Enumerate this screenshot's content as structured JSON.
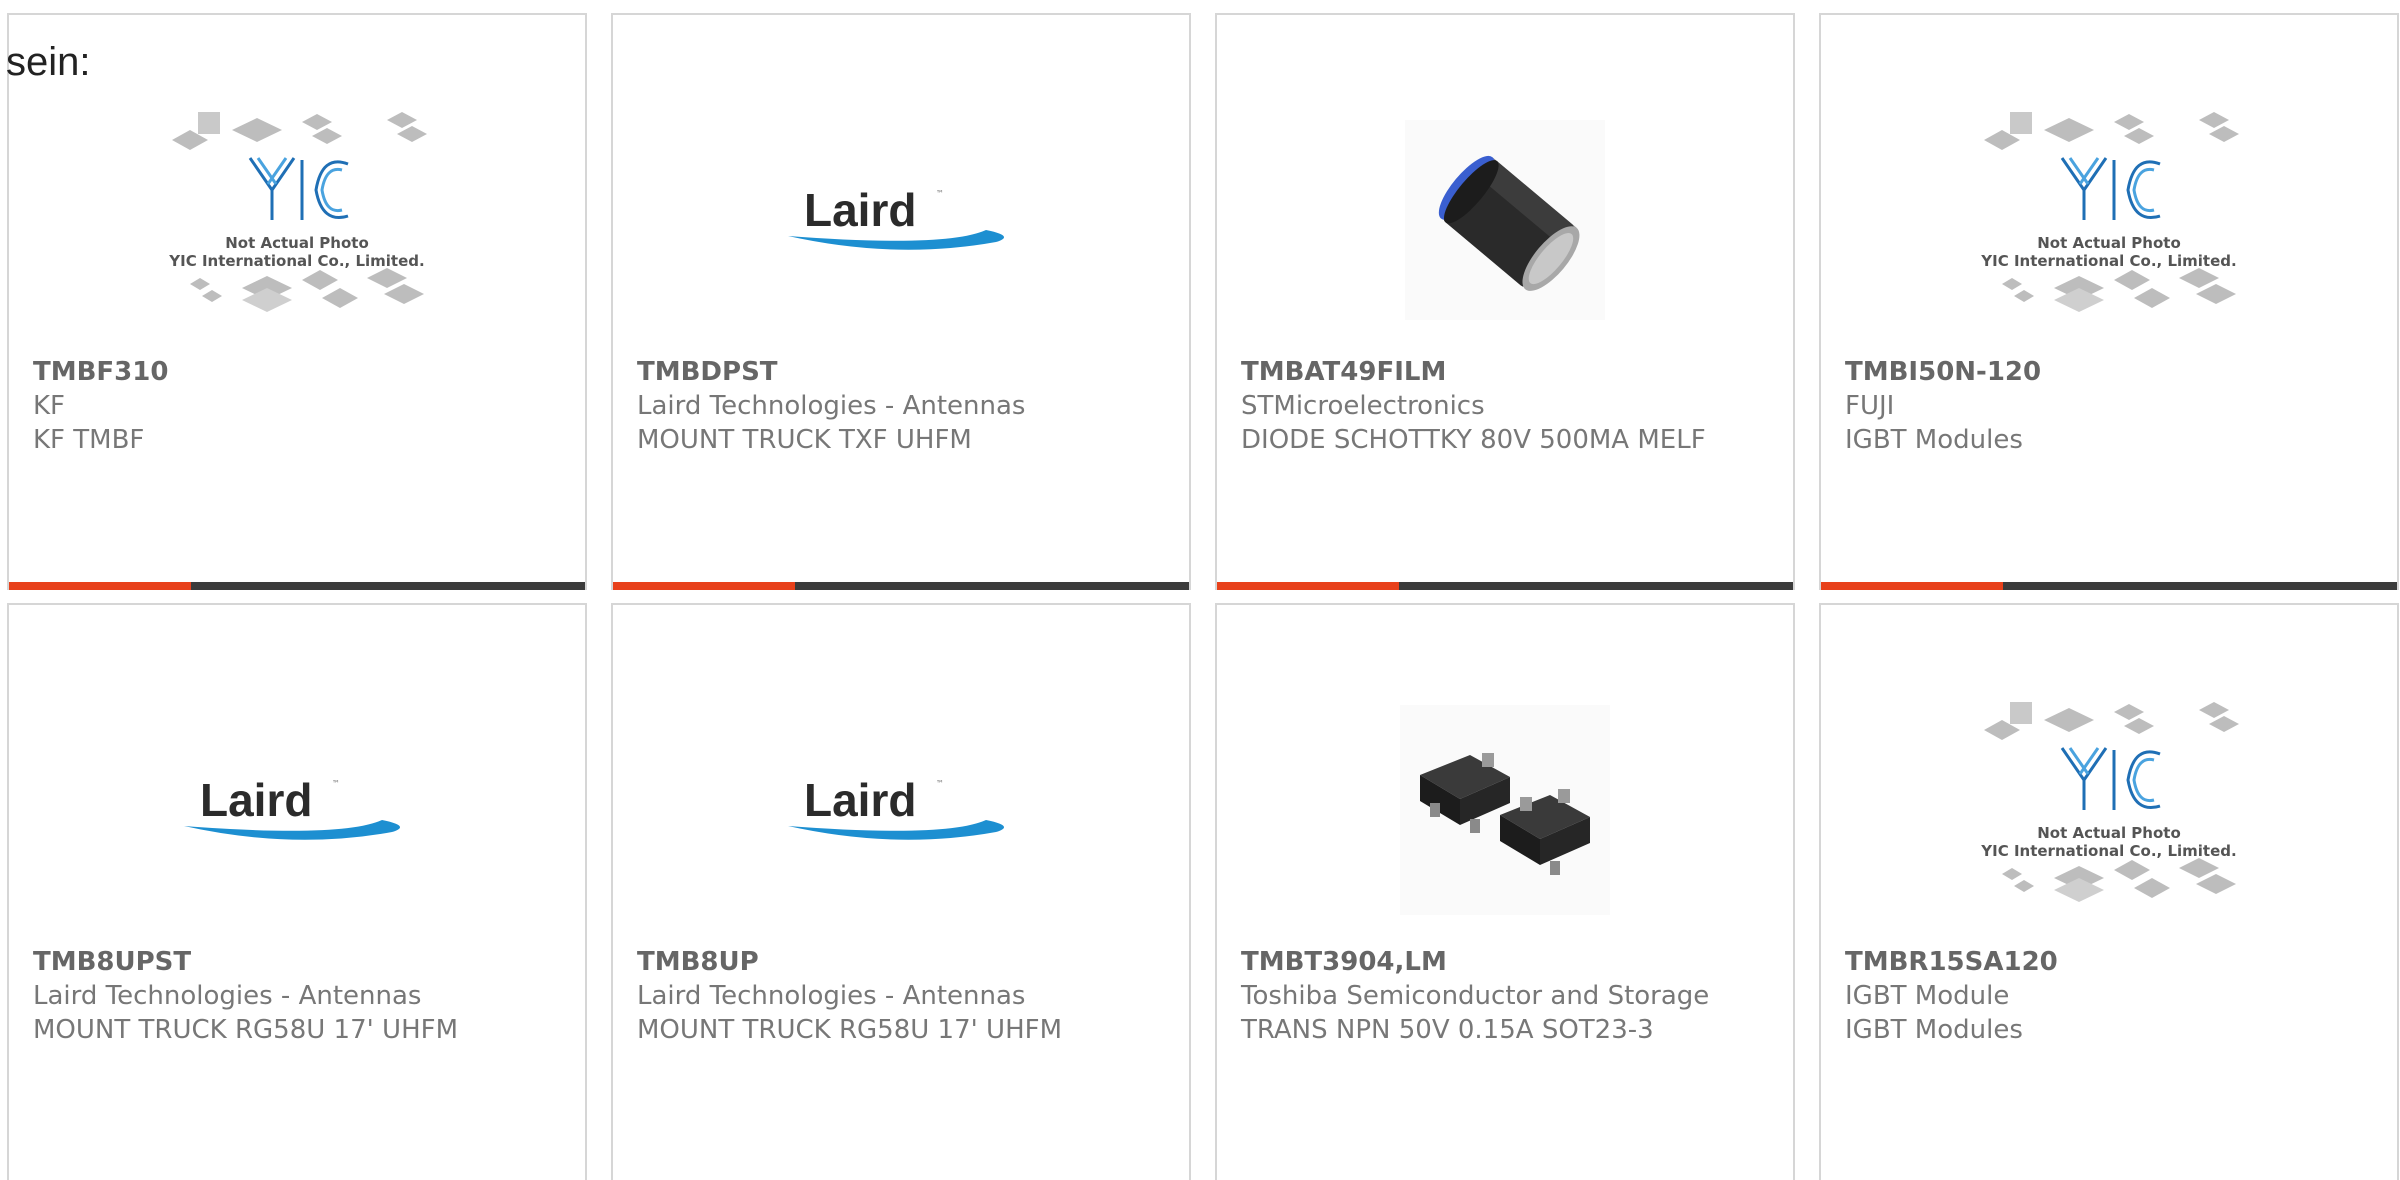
{
  "intro_text": "sein:",
  "placeholder_lines": [
    "Not Actual Photo",
    "YIC International Co., Limited."
  ],
  "laird_logo_text": "Laird",
  "colors": {
    "accent": "#e8411b",
    "bar": "#3b3b3b",
    "border": "#d6d6d6",
    "text": "#777777",
    "laird_swoosh": "#1d8fd1"
  },
  "products": [
    {
      "part": "TMBF310",
      "manufacturer": "KF",
      "description": "KF TMBF",
      "image": "yic-placeholder-icon"
    },
    {
      "part": "TMBDPST",
      "manufacturer": "Laird Technologies - Antennas",
      "description": "MOUNT TRUCK TXF UHFM",
      "image": "laird-logo"
    },
    {
      "part": "TMBAT49FILM",
      "manufacturer": "STMicroelectronics",
      "description": "DIODE SCHOTTKY 80V 500MA MELF",
      "image": "melf-diode-icon"
    },
    {
      "part": "TMBI50N-120",
      "manufacturer": "FUJI",
      "description": "IGBT Modules",
      "image": "yic-placeholder-icon"
    },
    {
      "part": "TMB8UPST",
      "manufacturer": "Laird Technologies - Antennas",
      "description": "MOUNT TRUCK RG58U 17' UHFM",
      "image": "laird-logo"
    },
    {
      "part": "TMB8UP",
      "manufacturer": "Laird Technologies - Antennas",
      "description": "MOUNT TRUCK RG58U 17' UHFM",
      "image": "laird-logo"
    },
    {
      "part": "TMBT3904,LM",
      "manufacturer": "Toshiba Semiconductor and Storage",
      "description": "TRANS NPN 50V 0.15A SOT23-3",
      "image": "sot23-package-icon"
    },
    {
      "part": "TMBR15SA120",
      "manufacturer": "IGBT Module",
      "description": "IGBT Modules",
      "image": "yic-placeholder-icon"
    }
  ]
}
